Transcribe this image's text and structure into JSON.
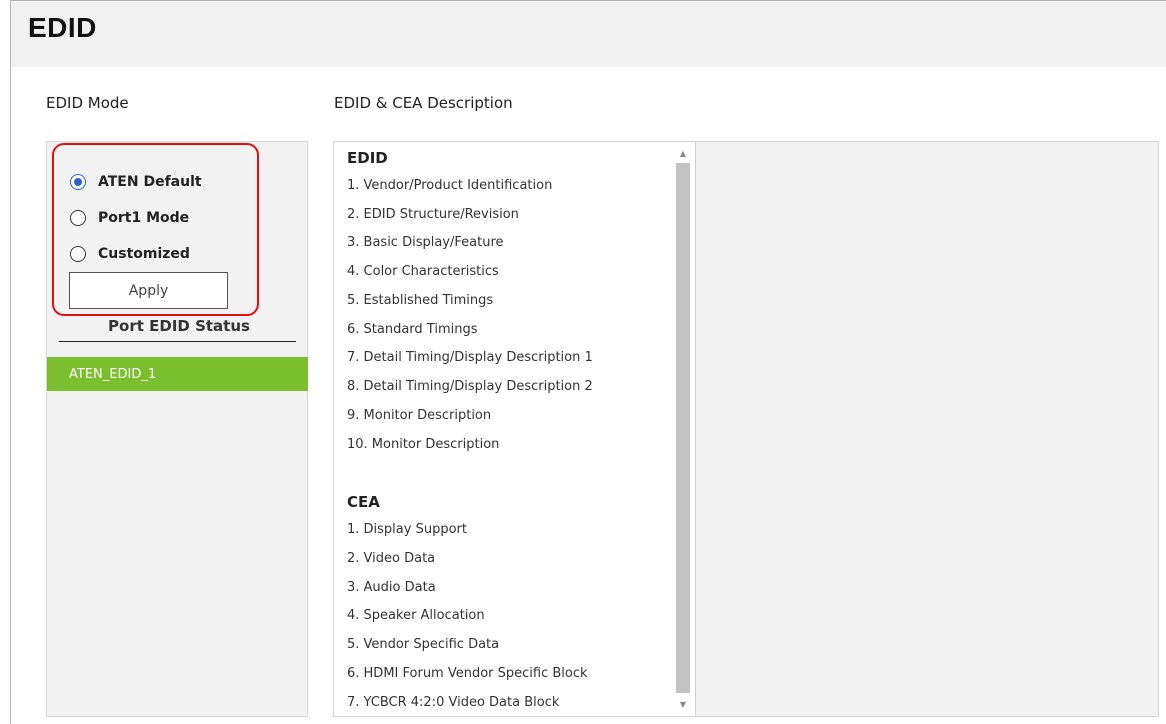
{
  "page": {
    "title": "EDID"
  },
  "mode_section": {
    "label": "EDID Mode"
  },
  "desc_section": {
    "label": "EDID & CEA Description"
  },
  "edid_mode": {
    "options": [
      {
        "label": "ATEN Default",
        "checked": true
      },
      {
        "label": "Port1 Mode",
        "checked": false
      },
      {
        "label": "Customized",
        "checked": false
      }
    ],
    "apply_label": "Apply"
  },
  "port_status": {
    "title": "Port EDID Status",
    "items": [
      {
        "label": "ATEN_EDID_1",
        "selected": true
      }
    ]
  },
  "description": {
    "edid_heading": "EDID",
    "edid_items": [
      "1. Vendor/Product Identification",
      "2. EDID Structure/Revision",
      "3. Basic Display/Feature",
      "4. Color Characteristics",
      "5. Established Timings",
      "6. Standard Timings",
      "7. Detail Timing/Display Description 1",
      "8. Detail Timing/Display Description 2",
      "9. Monitor Description",
      "10. Monitor Description"
    ],
    "cea_heading": "CEA",
    "cea_items": [
      "1. Display Support",
      "2. Video Data",
      "3. Audio Data",
      "4. Speaker Allocation",
      "5. Vendor Specific Data",
      "6. HDMI Forum Vendor Specific Block",
      "7. YCBCR 4:2:0 Video Data Block"
    ]
  },
  "colors": {
    "selected_row": "#7cbf2e",
    "highlight_border": "#e01010",
    "radio_accent": "#2a62c9"
  },
  "icons": {
    "scroll_up": "triangle-up",
    "scroll_down": "triangle-down"
  }
}
